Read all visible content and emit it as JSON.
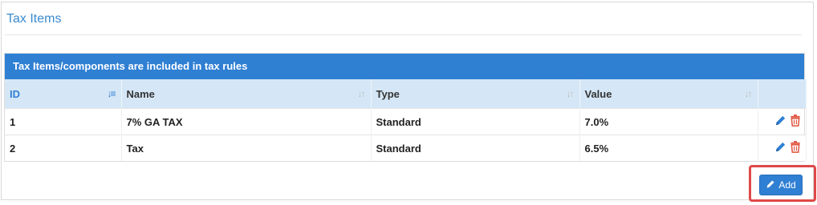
{
  "page": {
    "title": "Tax Items"
  },
  "panel": {
    "heading": "Tax Items/components are included in tax rules"
  },
  "table": {
    "columns": [
      "ID",
      "Name",
      "Type",
      "Value",
      ""
    ],
    "rows": [
      {
        "id": "1",
        "name": "7% GA TAX",
        "type": "Standard",
        "value": "7.0%"
      },
      {
        "id": "2",
        "name": "Tax",
        "type": "Standard",
        "value": "6.5%"
      }
    ]
  },
  "actions": {
    "add_label": "Add"
  },
  "icons": {
    "edit": "pencil-icon",
    "delete": "trash-icon",
    "sort": "sort-icon"
  },
  "colors": {
    "accent": "#2f7fd3",
    "delete": "#e0523c",
    "highlight": "#e04848"
  }
}
